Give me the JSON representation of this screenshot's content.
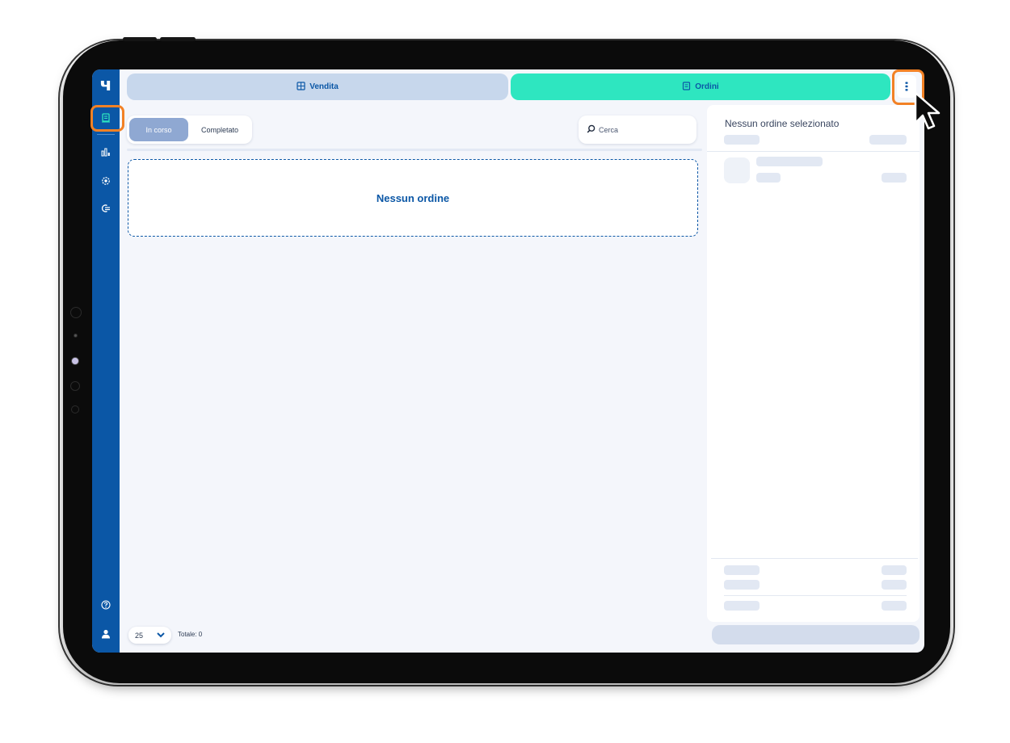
{
  "app": {
    "logo_glyph": "ч",
    "colors": {
      "brand": "#0b57a6",
      "accent": "#2ee6c0",
      "highlight": "#f28125"
    }
  },
  "sidebar": {
    "items": [
      {
        "icon": "orders-icon",
        "active": true
      },
      {
        "icon": "stats-icon"
      },
      {
        "icon": "settings-icon"
      },
      {
        "icon": "logout-icon"
      }
    ],
    "bottom_items": [
      {
        "icon": "help-icon"
      },
      {
        "icon": "user-icon"
      }
    ]
  },
  "tabs": [
    {
      "label": "Vendita",
      "icon": "register-icon",
      "active": false
    },
    {
      "label": "Ordini",
      "icon": "receipt-icon",
      "active": true
    }
  ],
  "filters": {
    "in_progress": "In corso",
    "completed": "Completato",
    "selected": "In corso"
  },
  "search": {
    "placeholder": "Cerca"
  },
  "orders": {
    "empty_message": "Nessun ordine",
    "items": []
  },
  "pagination": {
    "page_size": "25",
    "total_label": "Totale: 0"
  },
  "detail_panel": {
    "title": "Nessun ordine selezionato"
  }
}
